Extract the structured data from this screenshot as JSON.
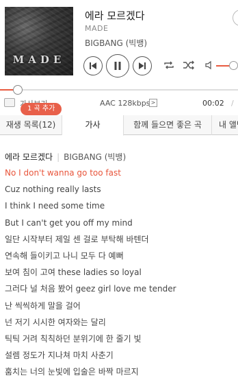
{
  "song": {
    "title": "에라 모르겠다",
    "album": "MADE",
    "artist": "BIGBANG (빅뱅)",
    "album_art_text": "MADE"
  },
  "player": {
    "progress_fraction": 0.07,
    "volume_fraction": 0.6,
    "lyrics_toggle_label": "가사보기",
    "codec": "AAC 128kbps",
    "current_time": "00:02",
    "time_separator": "/",
    "toast": "1 곡 추가"
  },
  "tabs": [
    {
      "label": "재생 목록(12)"
    },
    {
      "label": "가사"
    },
    {
      "label": "함께 들으면 좋은 곡"
    },
    {
      "label": "내 앨범"
    }
  ],
  "lyrics": {
    "header_title": "에라 모르겠다",
    "header_artist": "BIGBANG (빅뱅)",
    "lines": [
      "No I don't wanna go too fast",
      "Cuz nothing really lasts",
      "I think I need some time",
      "But I can't get you off my mind",
      "일단 시작부터 제일 센 걸로 부탁해 바텐더",
      "연속해 들이키고 나니 모두 다 예뻐",
      "보여 침이 고여 these ladies so loyal",
      "그러다 널 처음 봤어 geez girl love me tender",
      "난 씩씩하게 말을 걸어",
      "넌 저기 시시한 여자와는 달리",
      "틱틱 거려 칙칙하던 분위기에 한 줄기 빛",
      "설렘 정도가 지나쳐 마치 사춘기",
      "훔치는 너의 눈빛에 입술은 바짝 마르지"
    ],
    "current_index": 0
  },
  "colors": {
    "accent": "#e8553b"
  }
}
